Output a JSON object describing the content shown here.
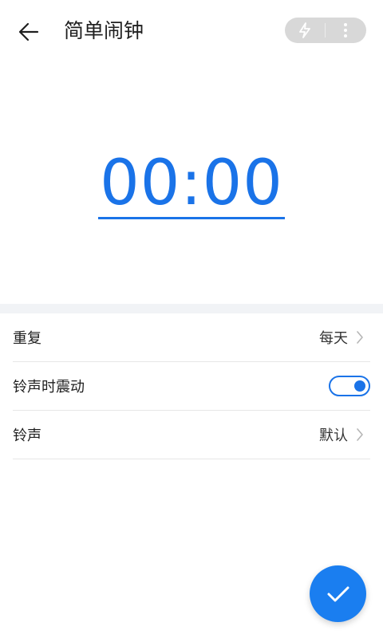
{
  "header": {
    "title": "简单闹钟",
    "back_icon": "arrow-left-icon",
    "capsule": {
      "action_icon": "flash-icon",
      "more_icon": "more-vertical-icon"
    }
  },
  "alarm": {
    "time": "00:00"
  },
  "settings": {
    "repeat": {
      "label": "重复",
      "value": "每天"
    },
    "vibrate": {
      "label": "铃声时震动",
      "enabled": true
    },
    "ringtone": {
      "label": "铃声",
      "value": "默认"
    }
  },
  "fab": {
    "icon": "check-icon"
  },
  "colors": {
    "accent": "#1a73e8",
    "fab": "#1a7ef0",
    "band": "#f1f3f6"
  }
}
